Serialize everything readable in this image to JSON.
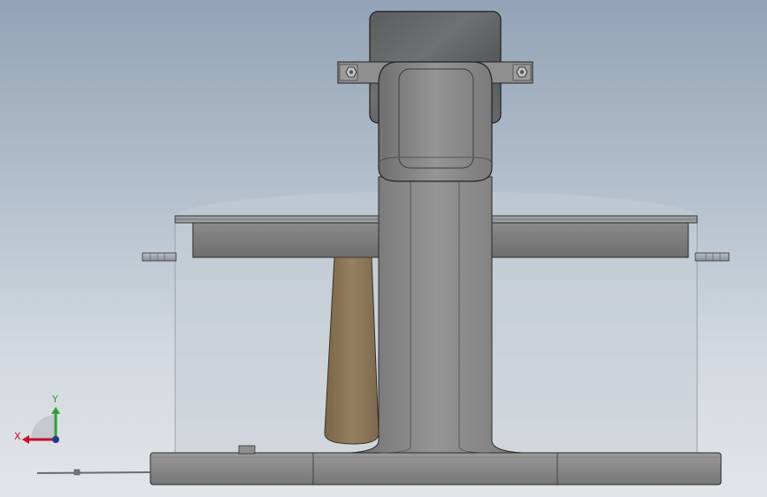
{
  "triad": {
    "x_label": "X",
    "y_label": "Y",
    "x_color": "#c8102e",
    "y_color": "#2e9e3a",
    "z_color": "#1e3c8c"
  },
  "model": {
    "gray_part_color": "#8d8d8d",
    "tan_part_color": "#8a7558",
    "dark_part_color": "#5c5f60",
    "glass_color": "#c6cdd6"
  }
}
